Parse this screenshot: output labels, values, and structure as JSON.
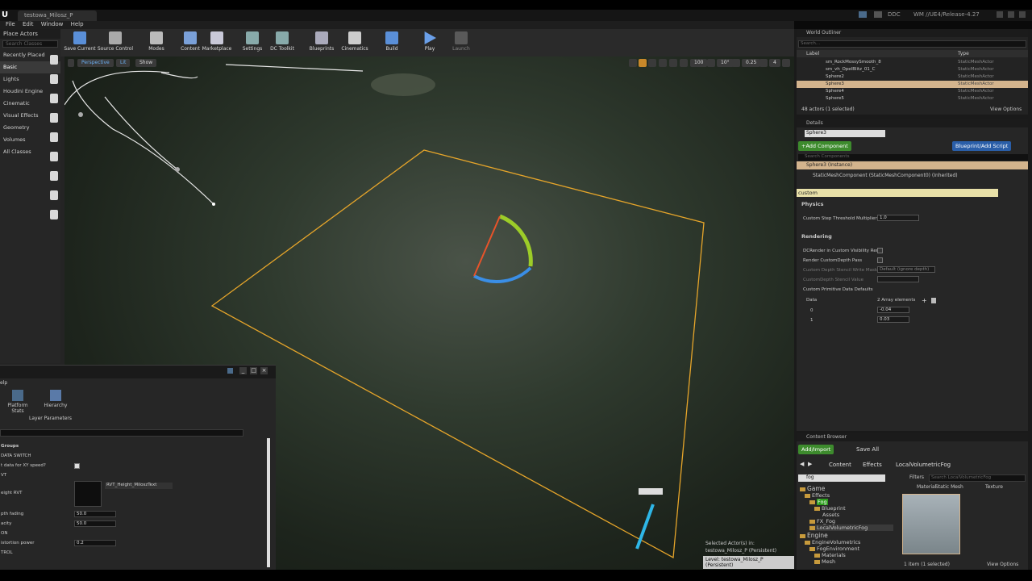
{
  "window": {
    "tab_title": "testowa_Milosz_P",
    "right_items": [
      "DDC",
      "WM //UE4/Release-4.27"
    ]
  },
  "menu": [
    "File",
    "Edit",
    "Window",
    "Help"
  ],
  "place_actors": {
    "title": "Place Actors",
    "search_placeholder": "Search Classes",
    "categories": [
      "Recently Placed",
      "Basic",
      "Lights",
      "Houdini Engine",
      "Cinematic",
      "Visual Effects",
      "Geometry",
      "Volumes",
      "All Classes"
    ]
  },
  "toolbar": [
    "Save Current",
    "Source Control",
    "Modes",
    "Content",
    "Marketplace",
    "Settings",
    "DC Toolkit",
    "Blueprints",
    "Cinematics",
    "Build",
    "Play",
    "Launch"
  ],
  "viewport": {
    "buttons": [
      "Perspective",
      "Lit",
      "Show"
    ],
    "snap_grid": "100",
    "snap_rot": "10°",
    "snap_scale": "0.25",
    "camera_speed": "4",
    "selected_line1": "Selected Actor(s) in:",
    "selected_line2": "testowa_Milosz_P (Persistent)",
    "level": "Level:  testowa_Milosz_P (Persistent)"
  },
  "layer_panel": {
    "tab_label": "elp",
    "buttons": [
      "Platform Stats",
      "Hierarchy"
    ],
    "subtab": "Layer Parameters",
    "rows": [
      {
        "label": "Groups",
        "value": ""
      },
      {
        "label": "DATA SWITCH",
        "value": ""
      },
      {
        "label": "t data for XY speed?",
        "value": "checked"
      },
      {
        "label": "VT",
        "value": ""
      },
      {
        "label": "eight RVT",
        "value": "RVT_Height_MiloszText"
      },
      {
        "label": "pth fading",
        "value": "50.0"
      },
      {
        "label": "acity",
        "value": "50.0"
      },
      {
        "label": "ON",
        "value": ""
      },
      {
        "label": "istortion power",
        "value": "0.2"
      },
      {
        "label": "TROL",
        "value": ""
      }
    ]
  },
  "world_outliner": {
    "title": "World Outliner",
    "search_placeholder": "Search...",
    "col_label": "Label",
    "col_type": "Type",
    "rows": [
      {
        "label": "sm_RockMossySmooth_8",
        "type": "StaticMeshActor",
        "selected": false
      },
      {
        "label": "sm_vh_OpelBlitz_01_C",
        "type": "StaticMeshActor",
        "selected": false
      },
      {
        "label": "Sphere2",
        "type": "StaticMeshActor",
        "selected": false
      },
      {
        "label": "Sphere3",
        "type": "StaticMeshActor",
        "selected": true
      },
      {
        "label": "Sphere4",
        "type": "StaticMeshActor",
        "selected": false
      },
      {
        "label": "Sphere5",
        "type": "StaticMeshActor",
        "selected": false
      }
    ],
    "footer": "48 actors (1 selected)",
    "view_options": "View Options"
  },
  "details": {
    "title": "Details",
    "actor_name": "Sphere3",
    "add_component": "+Add Component",
    "blueprint_btn": "Blueprint/Add Script",
    "search_components_placeholder": "Search Components",
    "instance_row": "Sphere3 (Instance)",
    "component_row": "StaticMeshComponent (StaticMeshComponent0) (Inherited)",
    "filter_value": "custom",
    "physics_header": "Physics",
    "custom_step_label": "Custom Step Threshold Multiplier",
    "custom_step_value": "1.0",
    "rendering_header": "Rendering",
    "render_visibility": "DCRender in Custom Visibility Rend",
    "render_depth": "Render CustomDepth Pass",
    "stencil_mask_label": "Custom Depth Stencil Write Mask",
    "stencil_mask_value": "Default (ignore depth)",
    "stencil_value_label": "CustomDepth Stencil Value",
    "primitive_defaults": "Custom Primitive Data Defaults",
    "data_label": "Data",
    "array_count": "2 Array elements",
    "elements": [
      {
        "index": "0",
        "value": "-0.04"
      },
      {
        "index": "1",
        "value": "0.03"
      }
    ]
  },
  "content_browser": {
    "title": "Content Browser",
    "add_import": "Add/Import",
    "save_all": "Save All",
    "breadcrumb": [
      "Content",
      "Effects",
      "LocalVolumetricFog"
    ],
    "search_value": "fog",
    "filters": "Filters",
    "search_assets_placeholder": "Search LocalVolumetricFog",
    "type_tabs": [
      "Material",
      "Static Mesh",
      "Texture"
    ],
    "tree": [
      {
        "label": "Game",
        "indent": 0,
        "hl": false
      },
      {
        "label": "Effects",
        "indent": 1,
        "hl": false
      },
      {
        "label": "Fog",
        "indent": 2,
        "hl": true
      },
      {
        "label": "Blueprint",
        "indent": 3,
        "hl": false
      },
      {
        "label": "Assets",
        "indent": 4,
        "hl": false
      },
      {
        "label": "FX_Fog",
        "indent": 2,
        "hl": false
      },
      {
        "label": "LocalVolumetricFog",
        "indent": 2,
        "hl": false
      },
      {
        "label": "Engine",
        "indent": 0,
        "hl": false
      },
      {
        "label": "EngineVolumetrics",
        "indent": 1,
        "hl": false
      },
      {
        "label": "FogEnvironment",
        "indent": 2,
        "hl": false
      },
      {
        "label": "Materials",
        "indent": 3,
        "hl": false
      },
      {
        "label": "Mesh",
        "indent": 3,
        "hl": false
      }
    ],
    "footer": "1 item (1 selected)",
    "view_options": "View Options"
  },
  "colors": {
    "selection": "#d3b48d",
    "green_button": "#3d8b2d",
    "blue_button": "#2a5ea8",
    "selection_outline": "#e6a52a"
  }
}
